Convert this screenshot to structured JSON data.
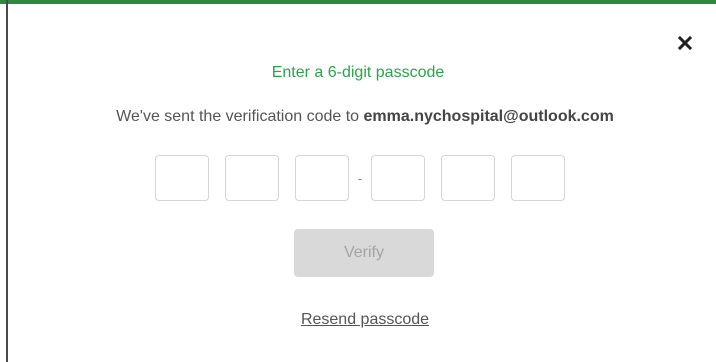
{
  "dialog": {
    "title": "Enter a 6-digit passcode",
    "subtitle_prefix": "We've sent the verification code to ",
    "email": "emma.nychospital@outlook.com",
    "separator": "-",
    "verify_label": "Verify",
    "resend_label": "Resend passcode",
    "close_icon": "close-icon",
    "colors": {
      "title": "#2aa44a",
      "button_bg": "#d9d9d9",
      "button_text": "#a3a3a3"
    }
  }
}
